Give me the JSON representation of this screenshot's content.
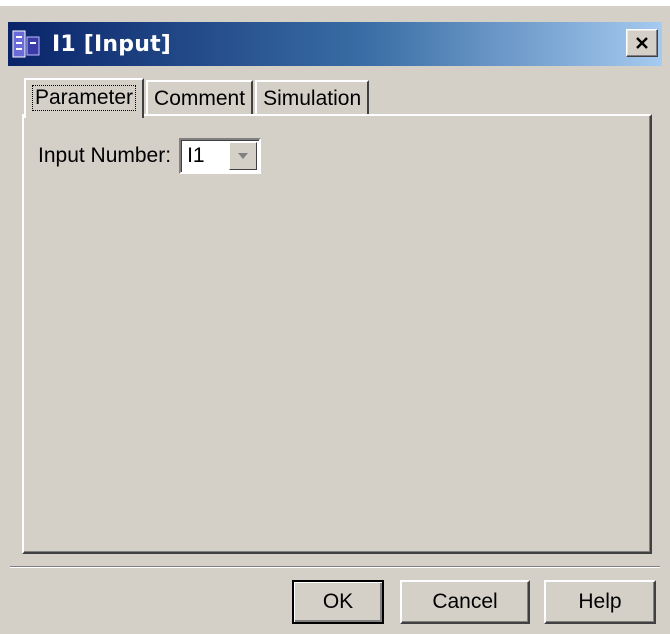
{
  "window": {
    "title": "I1 [Input]",
    "app_icon": "function-block-icon",
    "close_icon": "close-icon"
  },
  "tabs": [
    {
      "label": "Parameter",
      "active": true
    },
    {
      "label": "Comment",
      "active": false
    },
    {
      "label": "Simulation",
      "active": false
    }
  ],
  "parameter": {
    "input_number_label": "Input Number:",
    "input_number_value": "I1"
  },
  "buttons": {
    "ok": "OK",
    "cancel": "Cancel",
    "help": "Help"
  },
  "colors": {
    "titlebar_start": "#0a246a",
    "titlebar_end": "#a6caf0",
    "face": "#d4d0c8"
  }
}
